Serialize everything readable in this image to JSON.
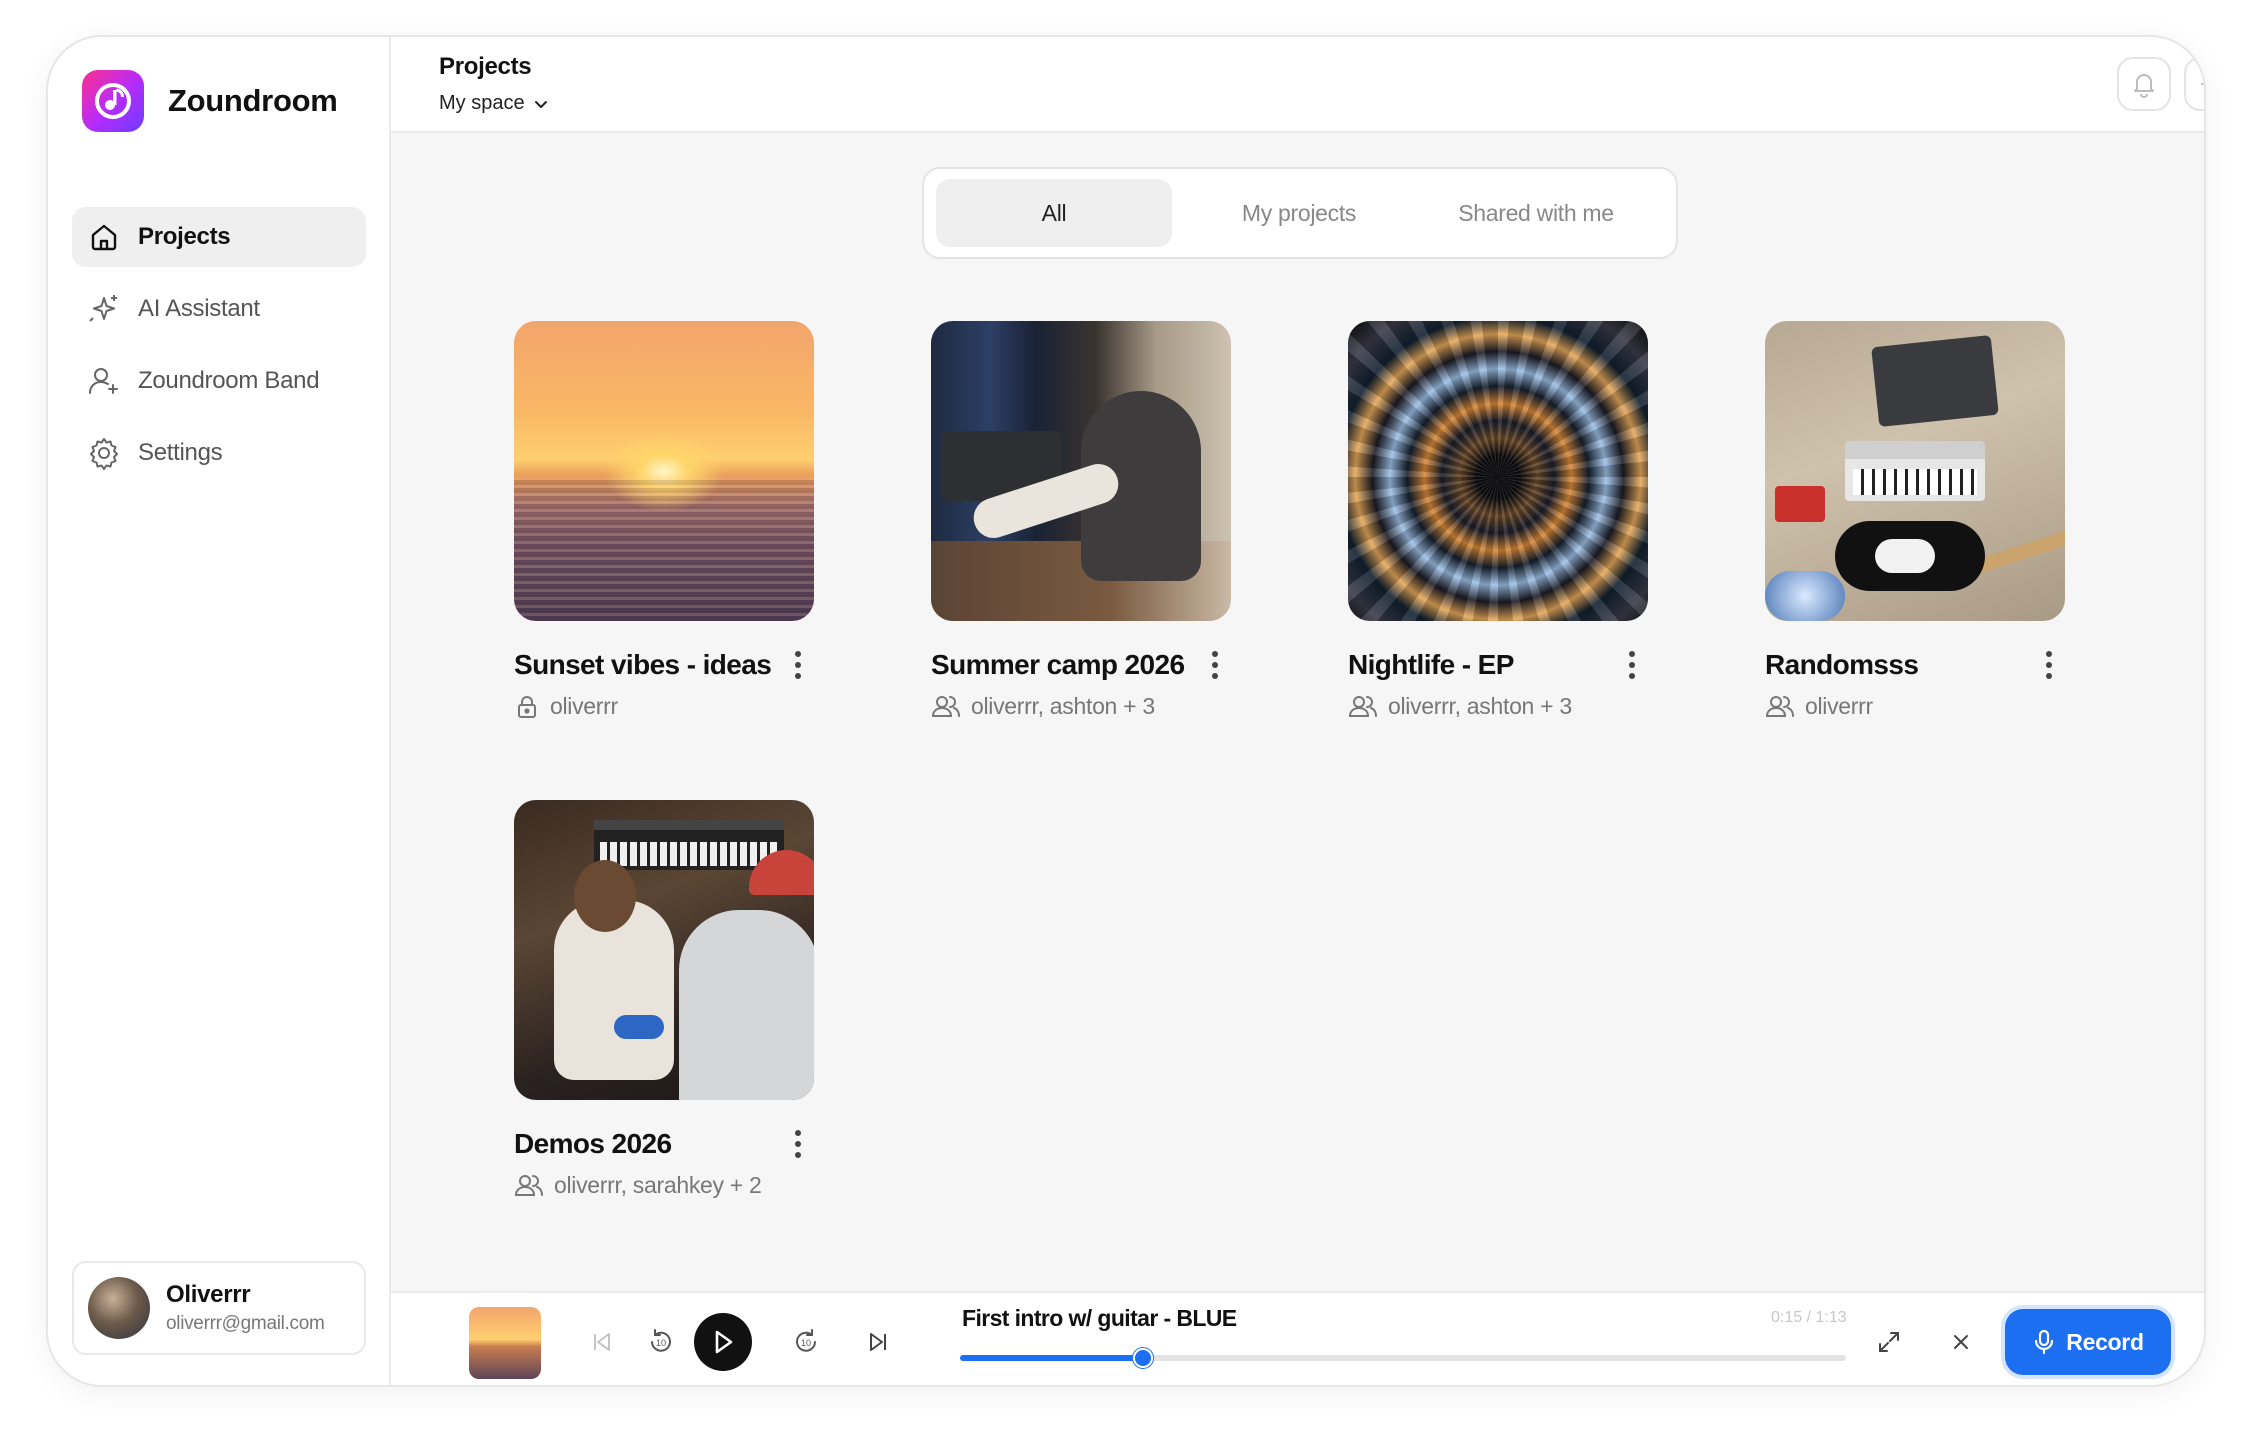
{
  "app": {
    "name": "Zoundroom"
  },
  "sidebar": {
    "items": [
      {
        "label": "Projects",
        "icon": "home-icon",
        "active": true
      },
      {
        "label": "AI Assistant",
        "icon": "sparkles-icon",
        "active": false
      },
      {
        "label": "Zoundroom Band",
        "icon": "user-plus-icon",
        "active": false
      },
      {
        "label": "Settings",
        "icon": "gear-icon",
        "active": false
      }
    ],
    "user": {
      "name": "Oliverrr",
      "email": "oliverrr@gmail.com"
    }
  },
  "header": {
    "title": "Projects",
    "space_selector": "My space"
  },
  "tabs": [
    {
      "label": "All",
      "active": true
    },
    {
      "label": "My projects",
      "active": false
    },
    {
      "label": "Shared with me",
      "active": false
    }
  ],
  "projects": [
    {
      "title": "Sunset vibes - ideas",
      "members": "oliverrr",
      "access_icon": "lock-icon"
    },
    {
      "title": "Summer camp 2026",
      "members": "oliverrr, ashton + 3",
      "access_icon": "users-icon"
    },
    {
      "title": "Nightlife - EP",
      "members": "oliverrr, ashton + 3",
      "access_icon": "users-icon"
    },
    {
      "title": "Randomsss",
      "members": "oliverrr",
      "access_icon": "users-icon"
    },
    {
      "title": "Demos 2026",
      "members": "oliverrr, sarahkey + 2",
      "access_icon": "users-icon"
    }
  ],
  "player": {
    "track_title": "First intro w/ guitar - BLUE",
    "time": "0:15 / 1:13",
    "progress": 0.207,
    "record_label": "Record"
  },
  "colors": {
    "accent": "#1d6ff2",
    "brand_gradient_start": "#ff2f8e",
    "brand_gradient_end": "#6a3cff"
  }
}
